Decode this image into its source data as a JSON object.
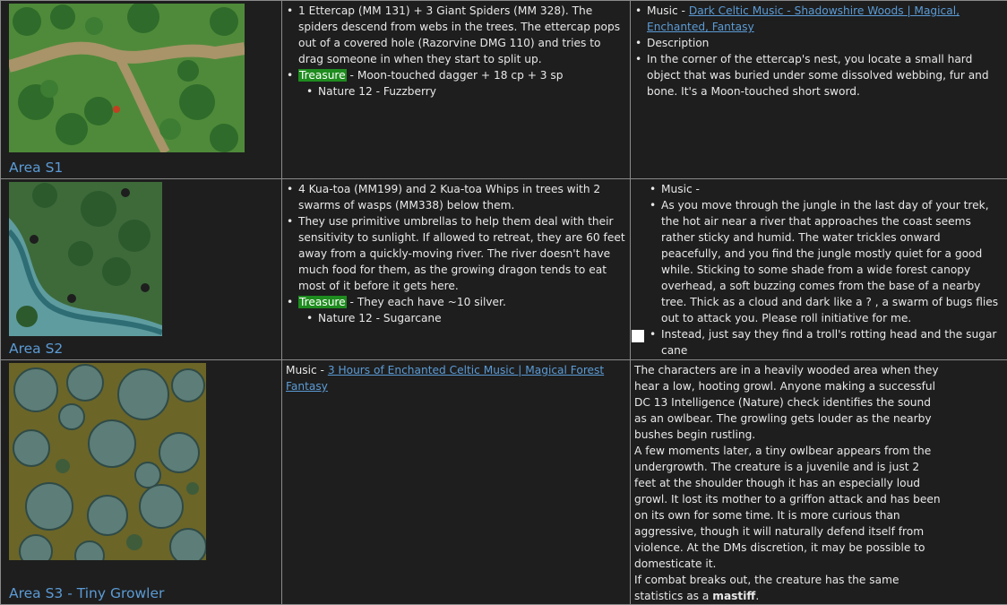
{
  "rows": [
    {
      "area": "Area S1",
      "col2": {
        "b1": "1 Ettercap (MM 131) + 3 Giant Spiders (MM 328). The spiders descend from webs in the trees. The ettercap pops out of a covered hole (Razorvine DMG 110) and tries to drag someone in when they start to split up.",
        "treasure_tag": "Treasure",
        "treasure_text": " - Moon-touched dagger + 18 cp + 3 sp",
        "sub": "Nature 12 - Fuzzberry"
      },
      "col3": {
        "music_prefix": "Music - ",
        "music_link": "Dark Celtic Music - Shadowshire Woods | Magical, Enchanted, Fantasy",
        "b2": "Description",
        "b3": "In the corner of the ettercap's nest, you locate a small hard object that was buried under some dissolved webbing, fur and bone. It's a Moon-touched short sword."
      }
    },
    {
      "area": "Area S2",
      "col2": {
        "b1": "4 Kua-toa (MM199) and 2 Kua-toa Whips in trees with 2 swarms of wasps (MM338) below them.",
        "b2": "They use primitive umbrellas to help them deal with their sensitivity to sunlight. If allowed to retreat, they are 60 feet away from a quickly-moving river. The river doesn't have much food for them, as the growing dragon tends to eat most of it before it gets here.",
        "treasure_tag": "Treasure",
        "treasure_text": " - They each have ~10 silver.",
        "sub": "Nature 12 - Sugarcane"
      },
      "col3": {
        "b1": "Music -",
        "b2": "As you move through the jungle in the last day of your trek, the hot air near a river that approaches the coast seems rather sticky and humid. The water trickles onward peacefully, and you find the jungle mostly quiet for a good while. Sticking to some shade from a wide forest canopy overhead, a soft buzzing comes from the base of a nearby tree. Thick as a cloud and dark like a ? , a swarm of bugs flies out to attack you. Please roll initiative for me.",
        "b3": "Instead, just say they find a troll's rotting head and the sugar cane"
      }
    },
    {
      "area": "Area S3 - Tiny Growler",
      "col2": {
        "music_prefix": "Music - ",
        "music_link": "3 Hours of Enchanted Celtic Music | Magical Forest Fantasy"
      },
      "col3": {
        "p1": "The characters are in a heavily wooded area when they hear a low, hooting growl. Anyone making a successful DC 13 Intelligence (Nature) check identifies the sound as an owlbear. The growling gets louder as the nearby bushes begin rustling.",
        "p2": "A few moments later, a tiny owlbear appears from the undergrowth. The creature is a juvenile and is just 2 feet at the shoulder though it has an especially loud growl. It lost its mother to a griffon attack and has been on its own for some time. It is more curious than aggressive, though it will naturally defend itself from violence. At the DMs discretion, it may be possible to domesticate it.",
        "p3_prefix": "If combat breaks out, the creature has the same statistics as a ",
        "p3_bold": "mastiff",
        "p3_suffix": "."
      }
    }
  ],
  "colors": {
    "background": "#1e1e1e",
    "text": "#e8e8e8",
    "link": "#5b9bd5",
    "treasure_highlight": "#1e8c1e",
    "border": "#8a8a8a"
  }
}
